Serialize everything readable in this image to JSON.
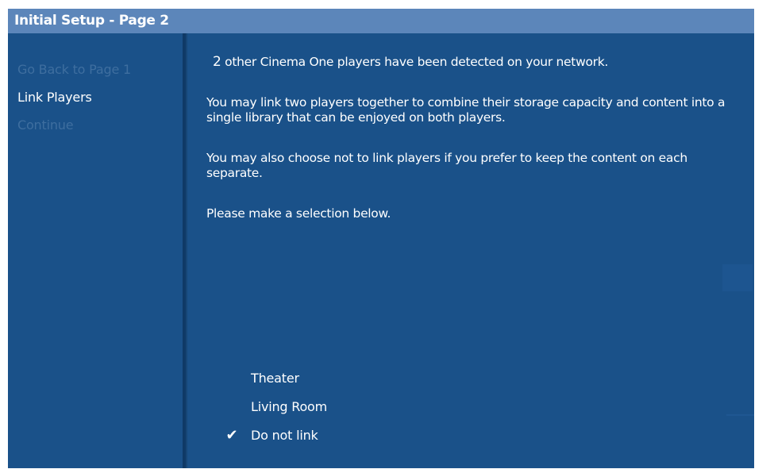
{
  "window": {
    "title": "Initial Setup - Page 2"
  },
  "sidebar": {
    "items": [
      {
        "label": "Go Back to Page 1",
        "state": "disabled"
      },
      {
        "label": "Link Players",
        "state": "active"
      },
      {
        "label": "Continue",
        "state": "disabled"
      }
    ]
  },
  "main": {
    "detected_count": "2",
    "detected_text": " other Cinema One players have been detected on your network.",
    "paragraph_link": "You may link two players together to combine their storage capacity and content into a single library that can be enjoyed on both players.",
    "paragraph_no_link": "You may also choose not to link players if you prefer to keep the content on each separate.",
    "paragraph_prompt": "Please make a selection below."
  },
  "options": {
    "items": [
      {
        "label": "Theater",
        "checked": false
      },
      {
        "label": "Living Room",
        "checked": false
      },
      {
        "label": "Do not link",
        "checked": true
      }
    ],
    "check_glyph": "✔"
  },
  "colors": {
    "background": "#1a5189",
    "titlebar": "#5c86ba",
    "text": "#ffffff",
    "disabled_text": "#3e6e9f",
    "divider": "#0f3966"
  }
}
